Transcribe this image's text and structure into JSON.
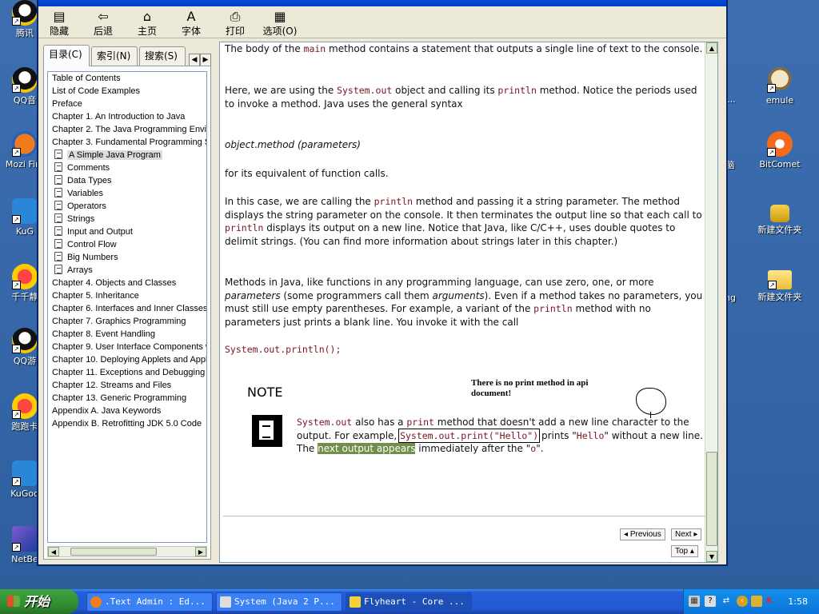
{
  "desktop": {
    "left_icons": [
      {
        "label": "腾讯",
        "icon": "qq-icon"
      },
      {
        "label": "QQ音",
        "icon": "qq-music-icon"
      },
      {
        "label": "Mozi Fire",
        "icon": "firefox-icon"
      },
      {
        "label": "KuG",
        "icon": "kugou-icon"
      },
      {
        "label": "千千静",
        "icon": "ttplayer-icon"
      },
      {
        "label": "QQ游",
        "icon": "qq-game-icon"
      },
      {
        "label": "跑跑卡",
        "icon": "kart-icon"
      },
      {
        "label": "KuGoo",
        "icon": "kugoo-icon"
      },
      {
        "label": "NetBe",
        "icon": "netbeans-icon"
      }
    ],
    "right_icons": [
      {
        "label": "emule",
        "icon": "emule-icon"
      },
      {
        "label": "BitComet",
        "icon": "bitcomet-icon"
      },
      {
        "label": "新建文件夹",
        "icon": "locked-folder-icon"
      },
      {
        "label": "新建文件夹",
        "icon": "folder-icon"
      }
    ],
    "behind_window_fragments": [
      "d...",
      "脑",
      "ng"
    ]
  },
  "toolbar": {
    "buttons": [
      {
        "label": "隐藏",
        "icon": "hide-icon"
      },
      {
        "label": "后退",
        "icon": "back-icon"
      },
      {
        "label": "主页",
        "icon": "home-icon"
      },
      {
        "label": "字体",
        "icon": "font-icon"
      },
      {
        "label": "打印",
        "icon": "print-icon"
      },
      {
        "label": "选项(O)",
        "icon": "options-icon"
      }
    ]
  },
  "nav": {
    "tabs": [
      {
        "label": "目录(C)"
      },
      {
        "label": "索引(N)"
      },
      {
        "label": "搜索(S)"
      }
    ],
    "toc": [
      {
        "label": "Table of Contents",
        "sub": false
      },
      {
        "label": "List of Code Examples",
        "sub": false
      },
      {
        "label": "Preface",
        "sub": false
      },
      {
        "label": "Chapter 1. An Introduction to Java",
        "sub": false
      },
      {
        "label": "Chapter 2. The Java Programming Envir",
        "sub": false
      },
      {
        "label": "Chapter 3. Fundamental Programming St",
        "sub": false
      },
      {
        "label": "A Simple Java Program",
        "sub": true,
        "selected": true
      },
      {
        "label": "Comments",
        "sub": true
      },
      {
        "label": "Data Types",
        "sub": true
      },
      {
        "label": "Variables",
        "sub": true
      },
      {
        "label": "Operators",
        "sub": true
      },
      {
        "label": "Strings",
        "sub": true
      },
      {
        "label": "Input and Output",
        "sub": true
      },
      {
        "label": "Control Flow",
        "sub": true
      },
      {
        "label": "Big Numbers",
        "sub": true
      },
      {
        "label": "Arrays",
        "sub": true
      },
      {
        "label": "Chapter 4. Objects and Classes",
        "sub": false
      },
      {
        "label": "Chapter 5. Inheritance",
        "sub": false
      },
      {
        "label": "Chapter 6. Interfaces and Inner Classes",
        "sub": false
      },
      {
        "label": "Chapter 7. Graphics Programming",
        "sub": false
      },
      {
        "label": "Chapter 8. Event Handling",
        "sub": false
      },
      {
        "label": "Chapter 9. User Interface Components w",
        "sub": false
      },
      {
        "label": "Chapter 10. Deploying Applets and Appli",
        "sub": false
      },
      {
        "label": "Chapter 11. Exceptions and Debugging",
        "sub": false
      },
      {
        "label": "Chapter 12. Streams and Files",
        "sub": false
      },
      {
        "label": "Chapter 13. Generic Programming",
        "sub": false
      },
      {
        "label": "Appendix A. Java Keywords",
        "sub": false
      },
      {
        "label": "Appendix B. Retrofitting JDK 5.0 Code",
        "sub": false
      }
    ]
  },
  "content": {
    "p1": {
      "a": "The body of the ",
      "code1": "main",
      "b": " method contains a statement that outputs a single line of text to the console."
    },
    "p2": {
      "a": "Here, we are using the ",
      "code1": "System.out",
      "b": " object and calling its ",
      "code2": "println",
      "c": " method. Notice the periods used to invoke a method. Java uses the general syntax"
    },
    "syntax": {
      "obj": "object",
      "dot": ".",
      "method": "method",
      "params": "(parameters)"
    },
    "p3": "for its equivalent of function calls.",
    "p4": {
      "a": "In this case, we are calling the ",
      "code1": "println",
      "b": " method and passing it a string parameter. The method displays the string parameter on the console. It then terminates the output line so that each call to ",
      "code2": "println",
      "c": " displays its output on a new line. Notice that Java, like C/C++, uses double quotes to delimit strings. (You can find more information about strings later in this chapter.)"
    },
    "p5": {
      "a": "Methods in Java, like functions in any programming language, can use zero, one, or more ",
      "em1": "parameters",
      "b": " (some programmers call them ",
      "em2": "arguments",
      "c": "). Even if a method takes no parameters, you must still use empty parentheses. For example, a variant of the ",
      "code1": "println",
      "d": " method with no parameters just prints a blank line. You invoke it with the call"
    },
    "code_line": "System.out.println();",
    "note_heading": "NOTE",
    "annotation": "There is no print method in api document!",
    "note": {
      "code1": "System.out",
      "a": " also has a ",
      "code2": "print",
      "b": " method that doesn't add a new line character to the output. For example, ",
      "code3": "System.out.print(\"Hello\")",
      "c": " prints \"",
      "code4": "Hello",
      "d": "\" without a new line. The ",
      "hl": "next output appears",
      "e": " immediately after the \"",
      "code5": "o",
      "f": "\"."
    },
    "nav_buttons": {
      "previous": "Previous",
      "next": "Next",
      "top": "Top"
    }
  },
  "taskbar": {
    "start": "开始",
    "tasks": [
      {
        "label": ".Text Admin : Ed...",
        "icon": "firefox-icon"
      },
      {
        "label": "System (Java 2 P...",
        "icon": "help-doc-icon"
      },
      {
        "label": "Flyheart - Core ...",
        "icon": "chm-icon",
        "active": true
      }
    ],
    "clock": "1:58"
  },
  "colors": {
    "code": "#7a1320",
    "highlight": "#6f8f4a",
    "taskbar": "#245edb"
  }
}
